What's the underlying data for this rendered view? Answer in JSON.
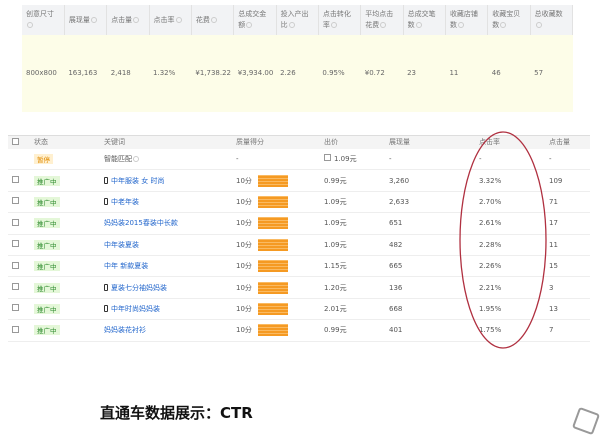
{
  "summary": {
    "headers": [
      "创意尺寸",
      "展现量",
      "点击量",
      "点击率",
      "花费",
      "总成交金额",
      "投入产出比",
      "点击转化率",
      "平均点击花费",
      "总成交笔数",
      "收藏店铺数",
      "收藏宝贝数",
      "总收藏数"
    ],
    "values": [
      "800x800",
      "163,163",
      "2,418",
      "1.32%",
      "¥1,738.22",
      "¥3,934.00",
      "2.26",
      "0.95%",
      "¥0.72",
      "23",
      "11",
      "46",
      "57"
    ]
  },
  "keywords": {
    "headers": [
      "状态",
      "关键词",
      "质量得分",
      "出价",
      "展现量",
      "点击率",
      "点击量"
    ],
    "smart": {
      "status": "暂停",
      "keyword": "智能匹配",
      "quality": "-",
      "bid": "1.09元",
      "impressions": "-",
      "ctr": "-",
      "clicks": "-"
    },
    "rows": [
      {
        "status": "推广中",
        "keyword": "中年服装 女 时尚",
        "mobile": true,
        "quality": "10分",
        "bid": "0.99元",
        "impressions": "3,260",
        "ctr": "3.32%",
        "clicks": "109"
      },
      {
        "status": "推广中",
        "keyword": "中老年装",
        "mobile": true,
        "quality": "10分",
        "bid": "1.09元",
        "impressions": "2,633",
        "ctr": "2.70%",
        "clicks": "71"
      },
      {
        "status": "推广中",
        "keyword": "妈妈装2015春装中长款",
        "mobile": false,
        "quality": "10分",
        "bid": "1.09元",
        "impressions": "651",
        "ctr": "2.61%",
        "clicks": "17"
      },
      {
        "status": "推广中",
        "keyword": "中年装夏装",
        "mobile": false,
        "quality": "10分",
        "bid": "1.09元",
        "impressions": "482",
        "ctr": "2.28%",
        "clicks": "11"
      },
      {
        "status": "推广中",
        "keyword": "中年 新款夏装",
        "mobile": false,
        "quality": "10分",
        "bid": "1.15元",
        "impressions": "665",
        "ctr": "2.26%",
        "clicks": "15"
      },
      {
        "status": "推广中",
        "keyword": "夏装七分袖妈妈装",
        "mobile": true,
        "quality": "10分",
        "bid": "1.20元",
        "impressions": "136",
        "ctr": "2.21%",
        "clicks": "3"
      },
      {
        "status": "推广中",
        "keyword": "中年时尚妈妈装",
        "mobile": true,
        "quality": "10分",
        "bid": "2.01元",
        "impressions": "668",
        "ctr": "1.95%",
        "clicks": "13"
      },
      {
        "status": "推广中",
        "keyword": "妈妈装花衬衫",
        "mobile": false,
        "quality": "10分",
        "bid": "0.99元",
        "impressions": "401",
        "ctr": "1.75%",
        "clicks": "7"
      }
    ]
  },
  "caption": "直通车数据展示：CTR",
  "colors": {
    "highlight_ellipse": "#b03040",
    "bar": "#f59a23"
  }
}
